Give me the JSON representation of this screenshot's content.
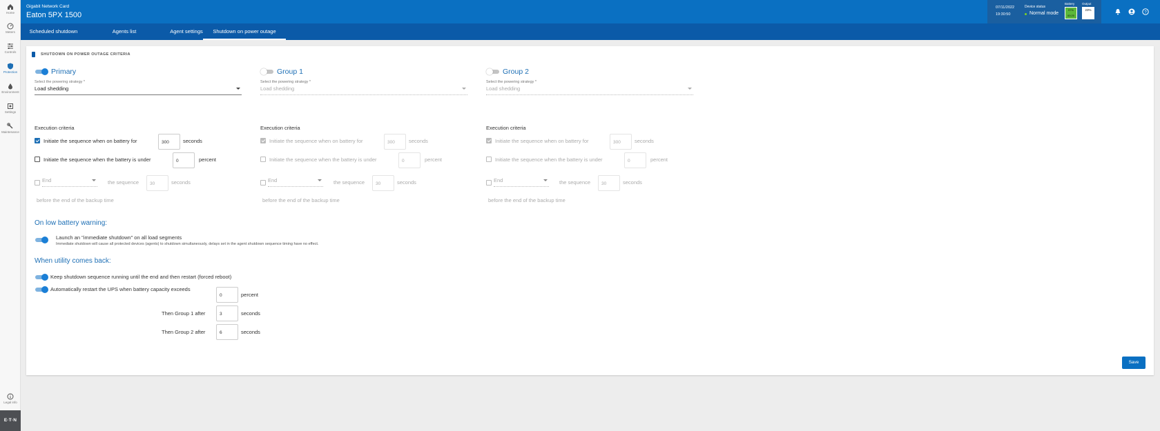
{
  "sidebar": {
    "items": [
      {
        "label": "Home",
        "icon": "home-icon"
      },
      {
        "label": "Meters",
        "icon": "meter-icon"
      },
      {
        "label": "Controls",
        "icon": "sliders-icon"
      },
      {
        "label": "Protection",
        "icon": "shield-icon"
      },
      {
        "label": "Environment",
        "icon": "droplet-icon"
      },
      {
        "label": "Settings",
        "icon": "gear-icon"
      },
      {
        "label": "Maintenance",
        "icon": "wrench-icon"
      }
    ],
    "legal_label": "Legal info",
    "logo_text": "E·T·N"
  },
  "header": {
    "subtitle": "Gigabit Network Card",
    "title": "Eaton 5PX 1500",
    "date": "07/11/2022",
    "time": "19:30:50",
    "device_status_label": "Device status",
    "device_status_value": "Normal mode",
    "battery_label": "Battery",
    "battery_value": "97%",
    "battery_runtime": "00:20",
    "output_label": "Output",
    "output_value": "23%",
    "colors": {
      "primary": "#0a70c2",
      "status_ok": "#7ed321"
    }
  },
  "tabs": [
    {
      "label": "Scheduled shutdown"
    },
    {
      "label": "Agents list"
    },
    {
      "label": "Agent settings"
    },
    {
      "label": "Shutdown on power outage"
    }
  ],
  "card": {
    "title": "SHUTDOWN ON POWER OUTAGE CRITERIA"
  },
  "groups": [
    {
      "name": "Primary",
      "enabled": true,
      "strategy_label": "Select the powering strategy *",
      "strategy_value": "Load shedding",
      "criteria_label": "Execution criteria",
      "battery_for_label": "Initiate the sequence when on battery for",
      "battery_for_value": "300",
      "battery_for_unit": "seconds",
      "battery_under_label": "Initiate the sequence when the battery is under",
      "battery_under_value": "0",
      "battery_under_unit": "percent",
      "end_label": "End",
      "end_sequence_text": "the sequence",
      "end_value": "30",
      "end_unit": "seconds",
      "end_hint": "before the end of the backup time"
    },
    {
      "name": "Group 1",
      "enabled": false,
      "strategy_label": "Select the powering strategy *",
      "strategy_value": "Load shedding",
      "criteria_label": "Execution criteria",
      "battery_for_label": "Initiate the sequence when on battery for",
      "battery_for_value": "300",
      "battery_for_unit": "seconds",
      "battery_under_label": "Initiate the sequence when the battery is under",
      "battery_under_value": "0",
      "battery_under_unit": "percent",
      "end_label": "End",
      "end_sequence_text": "the sequence",
      "end_value": "30",
      "end_unit": "seconds",
      "end_hint": "before the end of the backup time"
    },
    {
      "name": "Group 2",
      "enabled": false,
      "strategy_label": "Select the powering strategy *",
      "strategy_value": "Load shedding",
      "criteria_label": "Execution criteria",
      "battery_for_label": "Initiate the sequence when on battery for",
      "battery_for_value": "300",
      "battery_for_unit": "seconds",
      "battery_under_label": "Initiate the sequence when the battery is under",
      "battery_under_value": "0",
      "battery_under_unit": "percent",
      "end_label": "End",
      "end_sequence_text": "the sequence",
      "end_value": "30",
      "end_unit": "seconds",
      "end_hint": "before the end of the backup time"
    }
  ],
  "low_battery": {
    "heading": "On low battery warning:",
    "toggle_label": "Launch an \"immediate shutdown\" on all load segments",
    "note": "Immediate shutdown will cause all protected devices (agents) to shutdown simultaneously, delays set in the agent shutdown sequence timing have no effect."
  },
  "utility_back": {
    "heading": "When utility comes back:",
    "keep_label": "Keep shutdown sequence running until the end and then restart (forced reboot)",
    "restart_label": "Automatically restart the UPS when battery capacity exceeds",
    "restart_value": "0",
    "restart_unit": "percent",
    "group1_label": "Then Group 1 after",
    "group1_value": "3",
    "group1_unit": "seconds",
    "group2_label": "Then Group 2 after",
    "group2_value": "6",
    "group2_unit": "seconds"
  },
  "save_label": "Save"
}
